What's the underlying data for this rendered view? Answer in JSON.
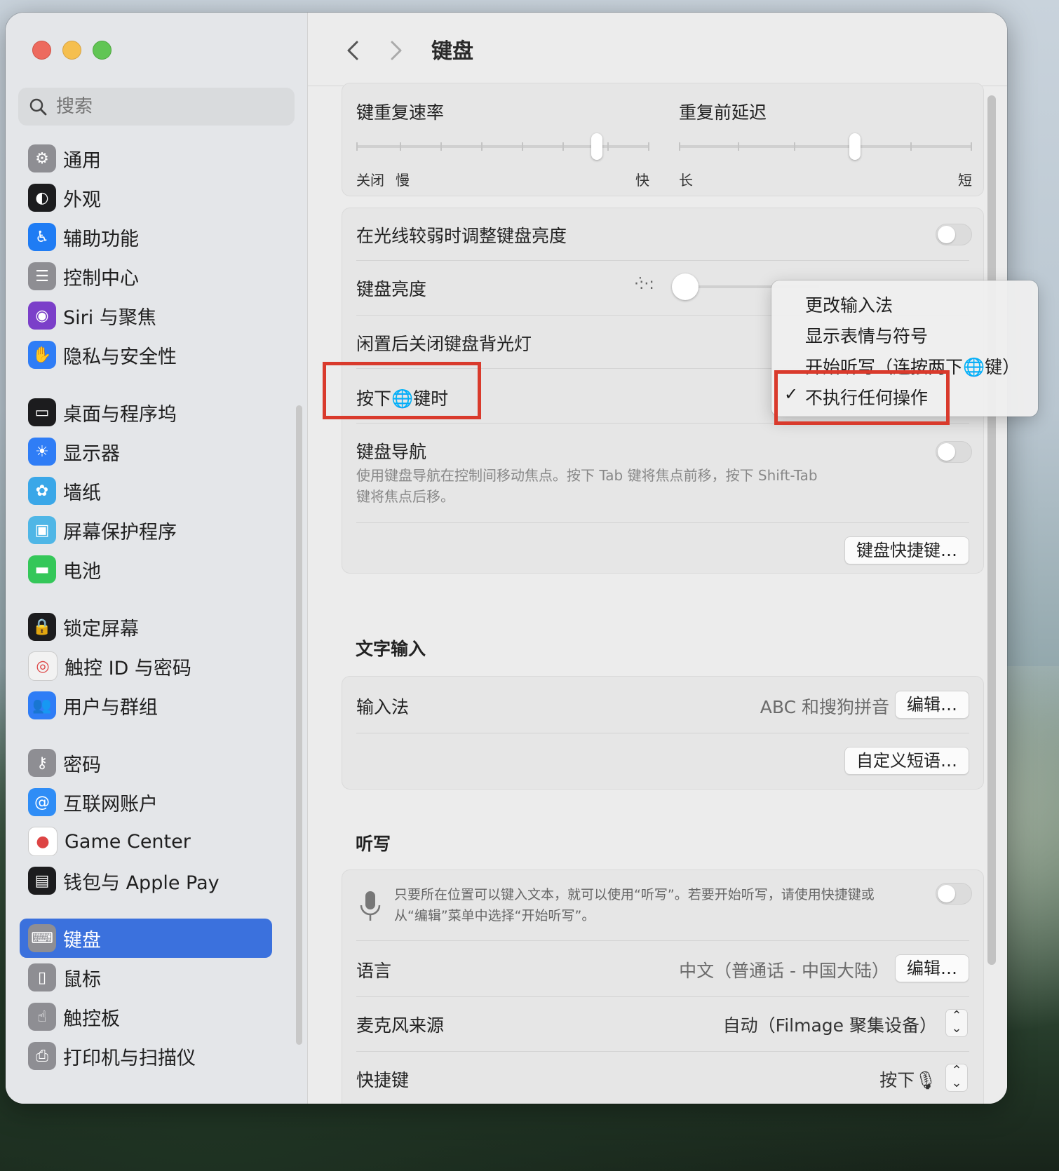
{
  "window": {
    "title": "键盘"
  },
  "sidebar": {
    "search_placeholder": "搜索",
    "groups": [
      [
        {
          "label": "通用",
          "icon": "gear-icon",
          "color": "#8e8e93"
        },
        {
          "label": "外观",
          "icon": "appearance-icon",
          "color": "#1c1c1e"
        },
        {
          "label": "辅助功能",
          "icon": "accessibility-icon",
          "color": "#1f7cf4"
        },
        {
          "label": "控制中心",
          "icon": "control-center-icon",
          "color": "#8e8e93"
        },
        {
          "label": "Siri 与聚焦",
          "icon": "siri-icon",
          "color": "#7b3fc9"
        },
        {
          "label": "隐私与安全性",
          "icon": "hand-icon",
          "color": "#2f7df6"
        }
      ],
      [
        {
          "label": "桌面与程序坞",
          "icon": "dock-icon",
          "color": "#1c1c1e"
        },
        {
          "label": "显示器",
          "icon": "sun-icon",
          "color": "#2f7df6"
        },
        {
          "label": "墙纸",
          "icon": "flower-icon",
          "color": "#3aa7e8"
        },
        {
          "label": "屏幕保护程序",
          "icon": "screensaver-icon",
          "color": "#4fb6e6"
        },
        {
          "label": "电池",
          "icon": "battery-icon",
          "color": "#34c759"
        }
      ],
      [
        {
          "label": "锁定屏幕",
          "icon": "lock-icon",
          "color": "#1c1c1e"
        },
        {
          "label": "触控 ID 与密码",
          "icon": "fingerprint-icon",
          "color": "#f2f2f2"
        },
        {
          "label": "用户与群组",
          "icon": "users-icon",
          "color": "#2f7df6"
        }
      ],
      [
        {
          "label": "密码",
          "icon": "key-icon",
          "color": "#8e8e93"
        },
        {
          "label": "互联网账户",
          "icon": "at-icon",
          "color": "#2f8df6"
        },
        {
          "label": "Game Center",
          "icon": "game-center-icon",
          "color": "#ffffff"
        },
        {
          "label": "钱包与 Apple Pay",
          "icon": "wallet-icon",
          "color": "#1c1c1e"
        }
      ],
      [
        {
          "label": "键盘",
          "icon": "keyboard-icon",
          "color": "#8e8e93",
          "selected": true
        },
        {
          "label": "鼠标",
          "icon": "mouse-icon",
          "color": "#8e8e93"
        },
        {
          "label": "触控板",
          "icon": "trackpad-icon",
          "color": "#8e8e93"
        },
        {
          "label": "打印机与扫描仪",
          "icon": "printer-icon",
          "color": "#8e8e93"
        }
      ]
    ]
  },
  "repeat": {
    "rate_label": "键重复速率",
    "delay_label": "重复前延迟",
    "rate_off": "关闭",
    "rate_slow": "慢",
    "rate_fast": "快",
    "delay_long": "长",
    "delay_short": "短",
    "rate_level": 0.82,
    "delay_level": 0.6
  },
  "brightness_group": {
    "auto_adjust_label": "在光线较弱时调整键盘亮度",
    "auto_adjust_on": false,
    "brightness_label": "键盘亮度",
    "brightness_level": 0.0,
    "backlight_off_label": "闲置后关闭键盘背光灯",
    "globe_key_label": "按下🌐键时",
    "nav_label": "键盘导航",
    "nav_on": false,
    "nav_desc_line1": "使用键盘导航在控制间移动焦点。按下 Tab 键将焦点前移，按下 Shift-Tab",
    "nav_desc_line2": "键将焦点后移。",
    "shortcuts_button": "键盘快捷键…"
  },
  "text_input": {
    "section_title": "文字输入",
    "input_sources_label": "输入法",
    "input_sources_value": "ABC 和搜狗拼音",
    "edit_button": "编辑…",
    "text_replacements_button": "自定义短语…"
  },
  "dictation": {
    "section_title": "听写",
    "description_line1": "只要所在位置可以键入文本，就可以使用“听写”。若要开始听写，请使用快捷键或",
    "description_line2": "从“编辑”菜单中选择“开始听写”。",
    "enabled": false,
    "language_label": "语言",
    "language_value": "中文（普通话 - 中国大陆）",
    "edit_button": "编辑…",
    "mic_source_label": "麦克风来源",
    "mic_source_value": "自动（Filmage 聚集设备）",
    "shortcut_label": "快捷键",
    "shortcut_value": "按下🎙"
  },
  "popup_menu": {
    "items": [
      "更改输入法",
      "显示表情与符号",
      "开始听写（连按两下🌐键）",
      "不执行任何操作"
    ],
    "checked_index": 3,
    "check_mark": "✓"
  }
}
